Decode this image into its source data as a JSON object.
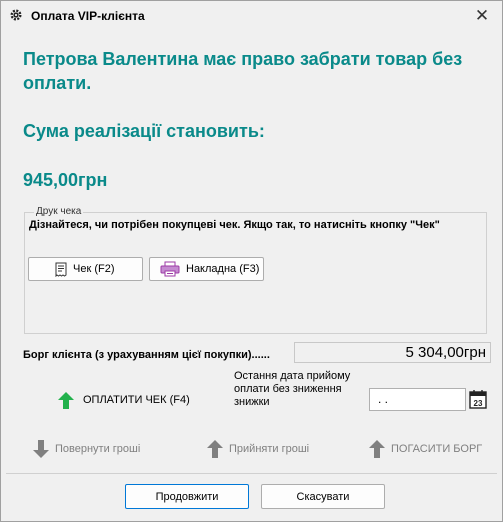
{
  "window": {
    "title": "Оплата VIP-клієнта",
    "close_glyph": "✕"
  },
  "headline": "Петрова Валентина має право забрати товар без оплати.",
  "sum_label": "Сума реалізації становить:",
  "sum_value": "945,00грн",
  "print_group": {
    "legend": "Друк чека",
    "info": "Дізнайтеся, чи потрібен покупцеві чек. Якщо так, то натисніть кнопку \"Чек\"",
    "check_button": "Чек (F2)",
    "invoice_button": "Накладна (F3)"
  },
  "debt": {
    "label": "Борг клієнта (з урахуванням цієї покупки)......",
    "value": "5 304,00грн"
  },
  "pay_check": "ОПЛАТИТИ ЧЕК (F4)",
  "date": {
    "label": "Остання дата прийому оплати без зниження знижки",
    "value": " .  .",
    "calendar_day": "23"
  },
  "actions": {
    "return_money": "Повернути гроші",
    "accept_money": "Прийняти гроші",
    "pay_debt": "ПОГАСИТИ БОРГ"
  },
  "footer": {
    "continue": "Продовжити",
    "cancel": "Скасувати"
  },
  "colors": {
    "accent_teal": "#0a8a8a",
    "pay_green": "#22b14c",
    "disabled_gray": "#808080"
  }
}
